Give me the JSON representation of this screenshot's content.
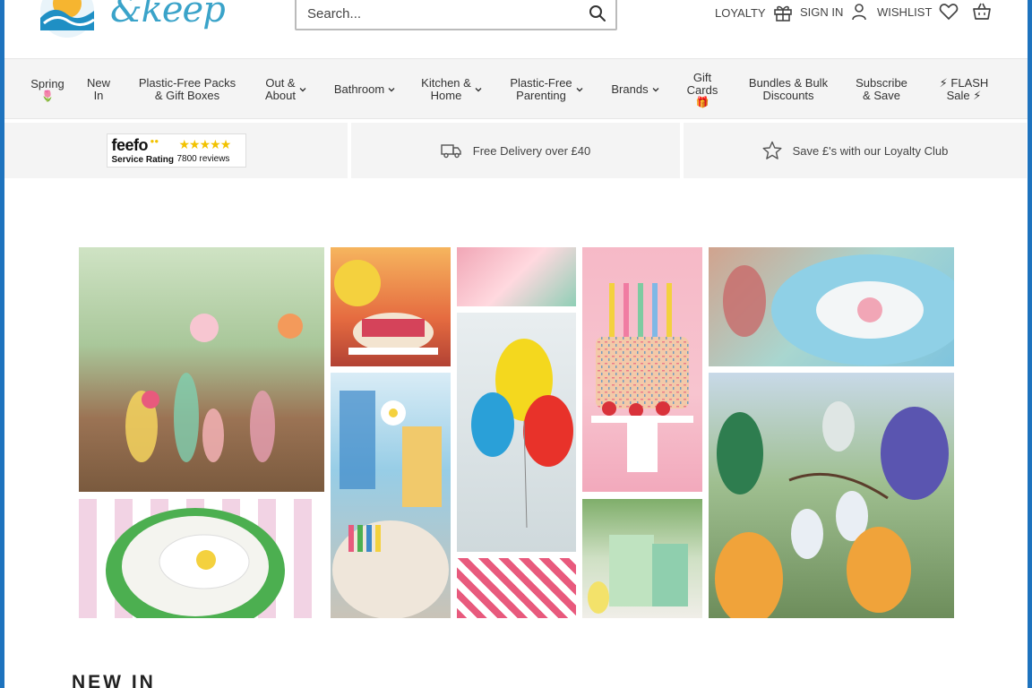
{
  "header": {
    "logo_text": "&keep",
    "search": {
      "placeholder": "Search..."
    },
    "loyalty_label": "LOYALTY",
    "signin_label": "SIGN IN",
    "wishlist_label": "WISHLIST"
  },
  "nav": {
    "items": [
      {
        "line1": "Spring",
        "line2": "🌷"
      },
      {
        "line1": "New",
        "line2": "In"
      },
      {
        "line1": "Plastic-Free Packs",
        "line2": "& Gift Boxes"
      },
      {
        "line1": "Out &",
        "line2": "About"
      },
      {
        "line1": "Bathroom",
        "line2": ""
      },
      {
        "line1": "Kitchen &",
        "line2": "Home"
      },
      {
        "line1": "Plastic-Free",
        "line2": "Parenting"
      },
      {
        "line1": "Brands",
        "line2": ""
      },
      {
        "line1": "Gift",
        "line2": "Cards",
        "line3": "🎁"
      },
      {
        "line1": "Bundles & Bulk",
        "line2": "Discounts"
      },
      {
        "line1": "Subscribe",
        "line2": "& Save"
      },
      {
        "line1": "⚡ FLASH",
        "line2": "Sale ⚡"
      }
    ]
  },
  "usp": {
    "feefo_brand": "feefo",
    "feefo_rating_label": "Service Rating",
    "feefo_reviews": "7800 reviews",
    "delivery": "Free Delivery over £40",
    "loyalty": "Save £'s with our Loyalty Club"
  },
  "section": {
    "title": "NEW IN"
  },
  "colors": {
    "frame": "#1e73be",
    "nav_bg": "#f4f4f4",
    "feefo_star": "#f2c200"
  }
}
